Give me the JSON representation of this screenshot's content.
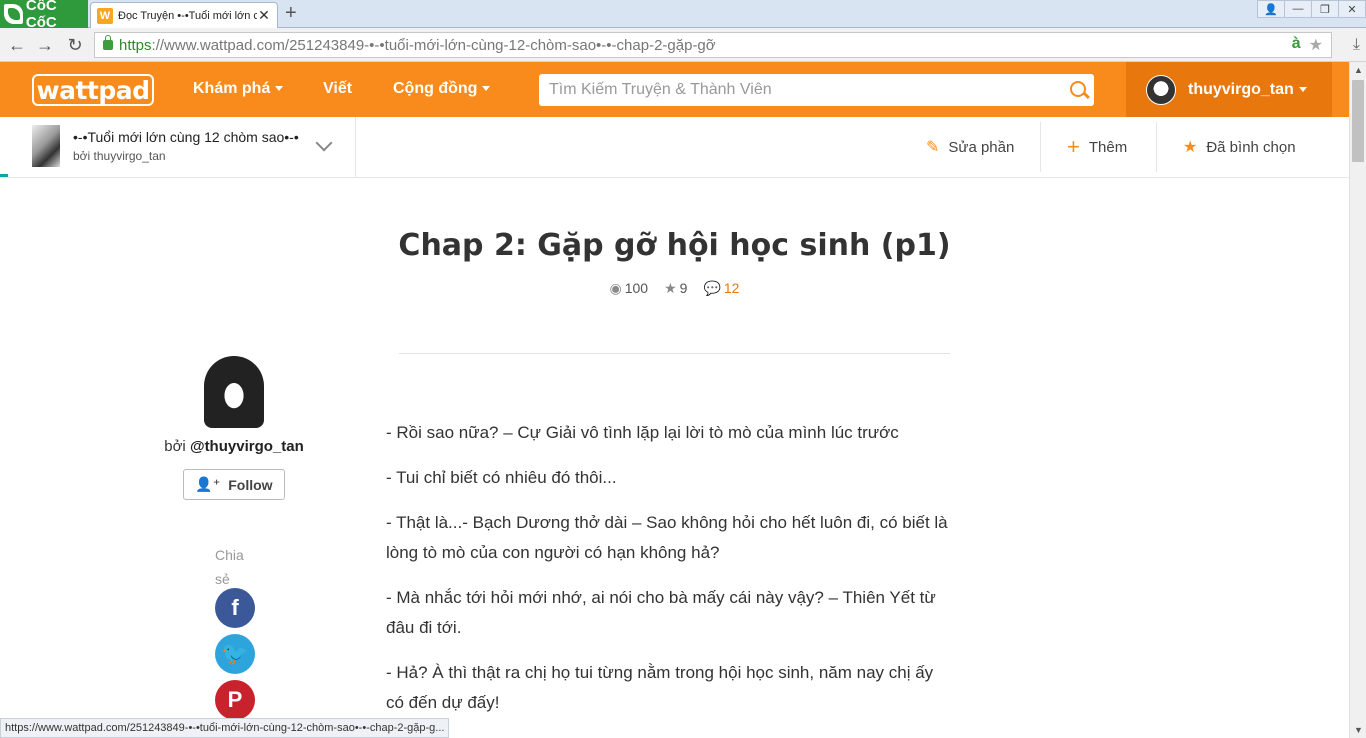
{
  "browser": {
    "brand": "CốC CốC",
    "tab_title": "Đọc Truyện •-•Tuổi mới lớn cù",
    "tab_favicon": "W",
    "url_https": "https",
    "url_rest": "://www.wattpad.com/251243849-•-•tuổi-mới-lớn-cùng-12-chòm-sao•-•-chap-2-gặp-gỡ",
    "status_url": "https://www.wattpad.com/251243849-•-•tuổi-mới-lớn-cùng-12-chòm-sao•-•-chap-2-gặp-g..."
  },
  "header": {
    "logo": "wattpad",
    "nav": [
      "Khám phá",
      "Viết",
      "Cộng đồng"
    ],
    "search_placeholder": "Tìm Kiếm Truyện & Thành Viên",
    "username": "thuyvirgo_tan"
  },
  "story": {
    "title": "•-•Tuổi mới lớn cùng 12 chòm sao•-•",
    "author_line": "bởi thuyvirgo_tan",
    "actions": {
      "edit": "Sửa phần",
      "add": "Thêm",
      "voted": "Đã bình chọn"
    }
  },
  "chapter": {
    "title": "Chap 2: Gặp gỡ hội học sinh (p1)",
    "reads": "100",
    "votes": "9",
    "comments": "12"
  },
  "author": {
    "by_prefix": "bởi ",
    "handle": "@thuyvirgo_tan",
    "follow_label": "Follow",
    "share_label": "Chia sẻ"
  },
  "paragraphs": [
    "- Rồi sao nữa? – Cự Giải vô tình lặp lại lời tò mò của mình lúc trước",
    "- Tui chỉ biết có nhiêu đó thôi...",
    "- Thật là...- Bạch Dương thở dài – Sao không hỏi cho hết luôn đi, có biết là lòng tò mò của con người có hạn không hả?",
    "- Mà nhắc tới hỏi mới nhớ, ai nói cho bà mấy cái này vậy? – Thiên Yết từ đâu đi tới.",
    "- Hả? À thì thật ra chị họ tui từng nằm trong hội học sinh, năm nay chị ấy có đến dự đấy!"
  ],
  "colors": {
    "accent": "#f88b1c",
    "accent_dark": "#e8770d",
    "facebook": "#3b5998",
    "twitter": "#2ea4dd",
    "pinterest": "#c8232c"
  }
}
